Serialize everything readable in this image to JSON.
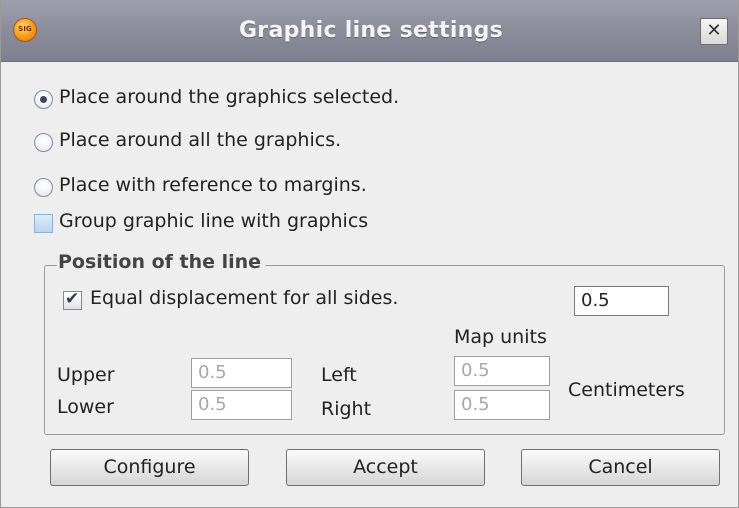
{
  "window": {
    "title": "Graphic line settings",
    "app_icon_text": "SIG",
    "close_glyph": "✕"
  },
  "options": {
    "radios": [
      {
        "label": "Place around the graphics selected.",
        "selected": true
      },
      {
        "label": "Place around all the graphics.",
        "selected": false
      },
      {
        "label": "Place with reference to margins.",
        "selected": false
      }
    ],
    "group_checkbox": {
      "label": "Group graphic line with graphics",
      "checked": false
    }
  },
  "position": {
    "title": "Position of the line",
    "equal_checkbox": {
      "label": "Equal displacement for all sides.",
      "checked": true,
      "glyph": "✔"
    },
    "equal_value": "0.5",
    "map_units_label": "Map units",
    "upper_label": "Upper",
    "upper_value": "0.5",
    "lower_label": "Lower",
    "lower_value": "0.5",
    "left_label": "Left",
    "left_value": "0.5",
    "right_label": "Right",
    "right_value": "0.5",
    "units_value": "Centimeters"
  },
  "buttons": {
    "configure": "Configure",
    "accept": "Accept",
    "cancel": "Cancel"
  },
  "colors": {
    "titlebar": "#8d8e9c",
    "background": "#eeeeee",
    "checkbox_blue": "#b9d5ef"
  }
}
